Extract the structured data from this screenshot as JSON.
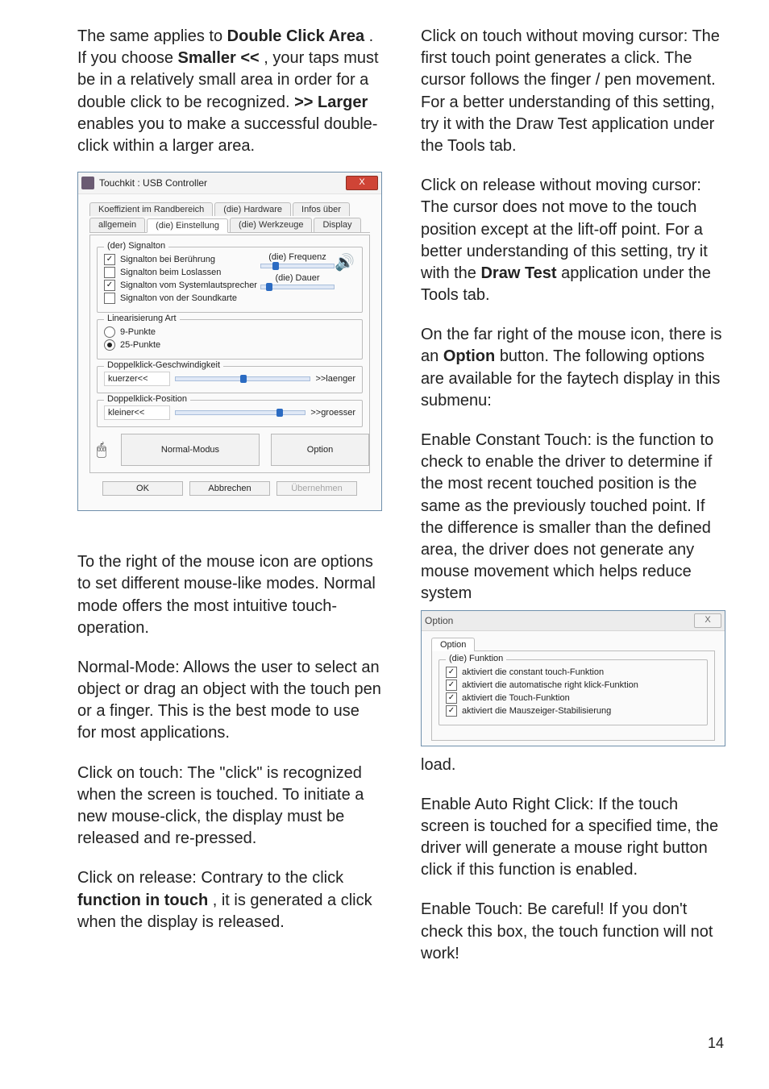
{
  "left": {
    "p1_pre": "The same applies to ",
    "p1_b1": "Double Click Area",
    "p1_mid1": ". If you choose ",
    "p1_b2": "Smaller <<",
    "p1_mid2": ", your taps must be in a relatively small area in order for a double click to be recognized. ",
    "p1_b3": ">> Larger",
    "p1_post": " enables you to make a successful double- click within a larger area.",
    "p2": "To the right of the mouse icon are options to set different mouse-like modes. Normal mode offers the most intuitive touch-operation.",
    "p3": "Normal-Mode: Allows the user to select an object or drag an object with the touch pen or a finger. This is the best mode to use for most applications.",
    "p4": "Click on touch: The \"click\" is recognized when the screen is touched.    To initiate a new mouse-click, the display must be released and re-pressed.",
    "p5_pre": "Click on release: Contrary to the click ",
    "p5_b": "function in touch",
    "p5_post": ", it is generated a click when the display is released."
  },
  "right": {
    "p1": "Click on touch without moving cursor: The first touch point generates a click. The cursor follows the finger / pen movement. For a better understanding of this setting, try it with the Draw Test application under the Tools tab.",
    "p2_pre": "Click on release without moving cursor: The cursor does not move to the touch position except at the lift-off point. For a better understanding of this setting, try it with the ",
    "p2_b": "Draw Test",
    "p2_post": " application under the Tools tab.",
    "p3_pre": "On the far right of the mouse icon, there is an ",
    "p3_b": "Option",
    "p3_post": " button. The following options are available for the faytech display in this submenu:",
    "p4": "Enable Constant Touch: is the function to check to enable the driver to determine if the most recent touched position is the same as the previously touched point. If the difference is smaller than the defined area, the driver does not generate any mouse movement which helps reduce system",
    "load": "load.",
    "p5": "Enable Auto Right Click: If the touch screen is touched for a specified time, the driver will generate a mouse right button click if this function is enabled.",
    "p6": "Enable Touch: Be careful! If you don't check this box, the touch function will not work!"
  },
  "dialog": {
    "title": "Touchkit : USB Controller",
    "close": "X",
    "tabs_row1": [
      "Koeffizient im Randbereich",
      "(die) Hardware",
      "Infos über"
    ],
    "tabs_row2": [
      "allgemein",
      "(die) Einstellung",
      "(die) Werkzeuge",
      "Display"
    ],
    "group_signal": "(der) Signalton",
    "chk_signal": [
      {
        "label": "Signalton bei Berührung",
        "checked": true
      },
      {
        "label": "Signalton beim Loslassen",
        "checked": false
      },
      {
        "label": "Signalton vom Systemlautsprecher",
        "checked": true
      },
      {
        "label": "Signalton von der Soundkarte",
        "checked": false
      }
    ],
    "slider_freq": "(die) Frequenz",
    "slider_dauer": "(die) Dauer",
    "group_lin": "Linearisierung Art",
    "rad_lin": [
      {
        "label": "9-Punkte",
        "selected": false
      },
      {
        "label": "25-Punkte",
        "selected": true
      }
    ],
    "group_speed": "Doppelklick-Geschwindigkeit",
    "speed_left": "kuerzer<<",
    "speed_right": ">>laenger",
    "group_pos": "Doppelklick-Position",
    "pos_left": "kleiner<<",
    "pos_right": ">>groesser",
    "mode_btn": "Normal-Modus",
    "option_btn": "Option",
    "ok": "OK",
    "cancel": "Abbrechen",
    "apply": "Übernehmen"
  },
  "option_dialog": {
    "title": "Option",
    "close": "X",
    "tab": "Option",
    "group": "(die) Funktion",
    "items": [
      {
        "label": "aktiviert die constant touch-Funktion",
        "checked": true
      },
      {
        "label": "aktiviert die automatische right klick-Funktion",
        "checked": true
      },
      {
        "label": "aktiviert die Touch-Funktion",
        "checked": true
      },
      {
        "label": "aktiviert die Mauszeiger-Stabilisierung",
        "checked": true
      }
    ]
  },
  "page_number": "14"
}
